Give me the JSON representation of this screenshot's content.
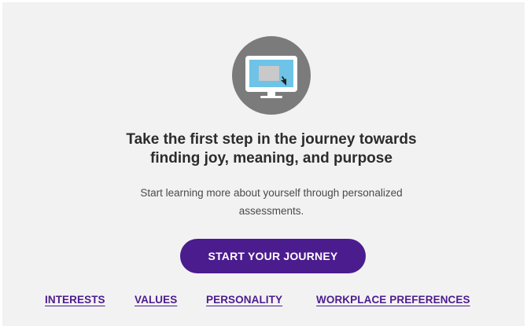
{
  "hero": {
    "icon": "computer-monitor-icon",
    "headline_line1": "Take the first step in the journey towards",
    "headline_line2": "finding joy, meaning, and purpose",
    "subtext_line1": "Start learning more about yourself through personalized",
    "subtext_line2": "assessments.",
    "cta_label": "START YOUR JOURNEY"
  },
  "links": {
    "interests": "INTERESTS",
    "values": "VALUES",
    "personality": "PERSONALITY",
    "workplace_preferences": "WORKPLACE PREFERENCES"
  },
  "colors": {
    "background": "#f3f2f3",
    "accent": "#4b1c8e",
    "icon_circle": "#7b7b7b",
    "monitor_screen": "#6ec3e6"
  }
}
